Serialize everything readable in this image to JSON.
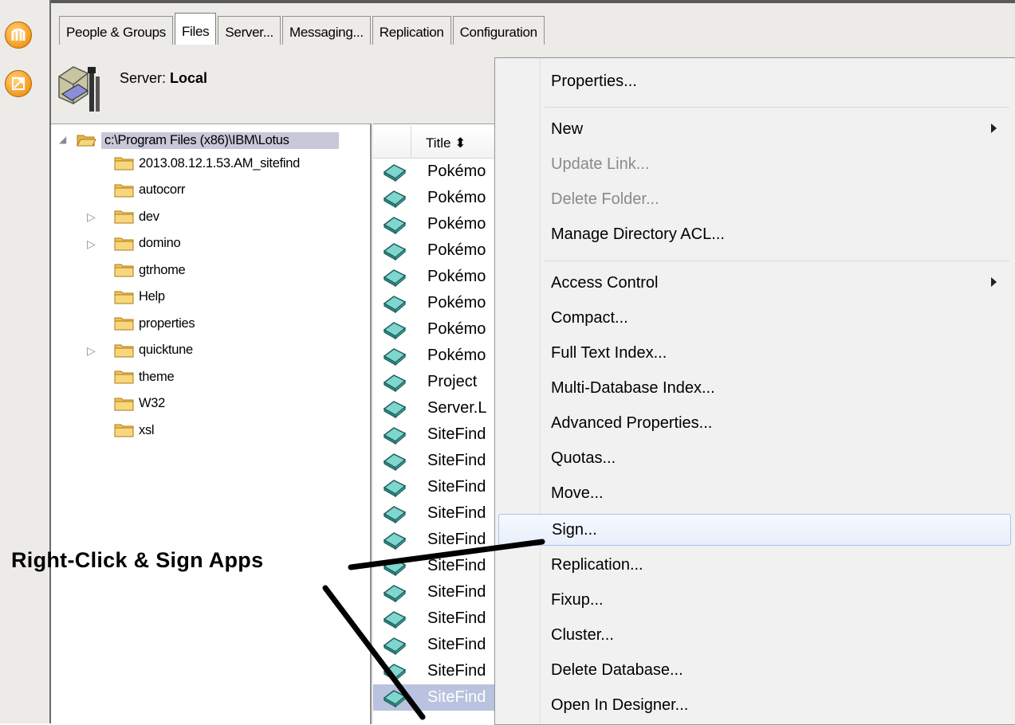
{
  "tabs": [
    {
      "label": "People & Groups"
    },
    {
      "label": "Files"
    },
    {
      "label": "Server..."
    },
    {
      "label": "Messaging..."
    },
    {
      "label": "Replication"
    },
    {
      "label": "Configuration"
    }
  ],
  "server": {
    "prefix": "Server:",
    "name": "Local"
  },
  "tree": {
    "root": "c:\\Program Files (x86)\\IBM\\Lotus",
    "folders": [
      "2013.08.12.1.53.AM_sitefind",
      "autocorr",
      "dev",
      "domino",
      "gtrhome",
      "Help",
      "properties",
      "quicktune",
      "theme",
      "W32",
      "xsl"
    ]
  },
  "files": {
    "column_title": "Title ⬍",
    "rows": [
      "Pokémo",
      "Pokémo",
      "Pokémo",
      "Pokémo",
      "Pokémo",
      "Pokémo",
      "Pokémo",
      "Pokémo",
      "Project",
      "Server.L",
      "SiteFind",
      "SiteFind",
      "SiteFind",
      "SiteFind",
      "SiteFind",
      "SiteFind",
      "SiteFind",
      "SiteFind",
      "SiteFind",
      "SiteFind",
      "SiteFind"
    ]
  },
  "menu": {
    "items": [
      {
        "label": "Properties..."
      },
      {
        "label": "New"
      },
      {
        "label": "Update Link..."
      },
      {
        "label": "Delete Folder..."
      },
      {
        "label": "Manage Directory ACL..."
      },
      {
        "label": "Access Control"
      },
      {
        "label": "Compact..."
      },
      {
        "label": "Full Text Index..."
      },
      {
        "label": "Multi-Database Index..."
      },
      {
        "label": "Advanced Properties..."
      },
      {
        "label": "Quotas..."
      },
      {
        "label": "Move..."
      },
      {
        "label": "Sign..."
      },
      {
        "label": "Replication..."
      },
      {
        "label": "Fixup..."
      },
      {
        "label": "Cluster..."
      },
      {
        "label": "Delete Database..."
      },
      {
        "label": "Open In Designer..."
      }
    ]
  },
  "annotation": {
    "text": "Right-Click & Sign Apps"
  },
  "colors": {
    "selection": "#b9c2de",
    "menu_hover_border": "#a9c3ea",
    "annotation": "#000000"
  }
}
